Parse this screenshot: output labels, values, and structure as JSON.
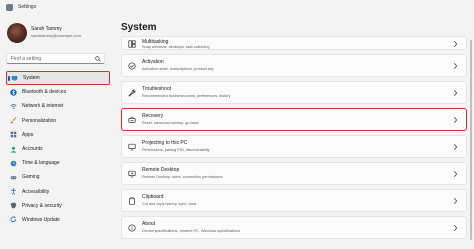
{
  "window": {
    "title": "Settings"
  },
  "account": {
    "name": "Sarah Tammy",
    "email": "sarahtammy@example.com"
  },
  "search": {
    "placeholder": "Find a setting"
  },
  "sidebar": {
    "items": [
      {
        "label": "System",
        "icon": "monitor-icon",
        "selected": true
      },
      {
        "label": "Bluetooth & devices",
        "icon": "bluetooth-icon"
      },
      {
        "label": "Network & internet",
        "icon": "wifi-icon"
      },
      {
        "label": "Personalization",
        "icon": "brush-icon"
      },
      {
        "label": "Apps",
        "icon": "apps-icon"
      },
      {
        "label": "Accounts",
        "icon": "person-icon"
      },
      {
        "label": "Time & language",
        "icon": "clock-globe-icon"
      },
      {
        "label": "Gaming",
        "icon": "gamepad-icon"
      },
      {
        "label": "Accessibility",
        "icon": "accessibility-icon"
      },
      {
        "label": "Privacy & security",
        "icon": "shield-icon"
      },
      {
        "label": "Windows Update",
        "icon": "update-icon"
      }
    ]
  },
  "main": {
    "title": "System",
    "cards": [
      {
        "title": "Multitasking",
        "desc": "Snap windows, desktops, task switching",
        "icon": "multitasking-icon"
      },
      {
        "title": "Activation",
        "desc": "Activation state, subscriptions, product key",
        "icon": "check-circle-icon"
      },
      {
        "title": "Troubleshoot",
        "desc": "Recommended troubleshooters, preferences, history",
        "icon": "wrench-icon"
      },
      {
        "title": "Recovery",
        "desc": "Reset, advanced startup, go back",
        "icon": "recovery-icon",
        "highlight": true
      },
      {
        "title": "Projecting to this PC",
        "desc": "Permissions, pairing PIN, discoverability",
        "icon": "projector-icon"
      },
      {
        "title": "Remote Desktop",
        "desc": "Remote Desktop users, connection permissions",
        "icon": "remote-desktop-icon"
      },
      {
        "title": "Clipboard",
        "desc": "Cut and copy history, sync, clear",
        "icon": "clipboard-icon"
      },
      {
        "title": "About",
        "desc": "Device specifications, rename PC, Windows specifications",
        "icon": "info-icon"
      }
    ]
  },
  "colors": {
    "accent": "#005fb8",
    "highlight": "#d32f2f",
    "background": "#f3f3f3",
    "card": "#fbfbfb"
  }
}
